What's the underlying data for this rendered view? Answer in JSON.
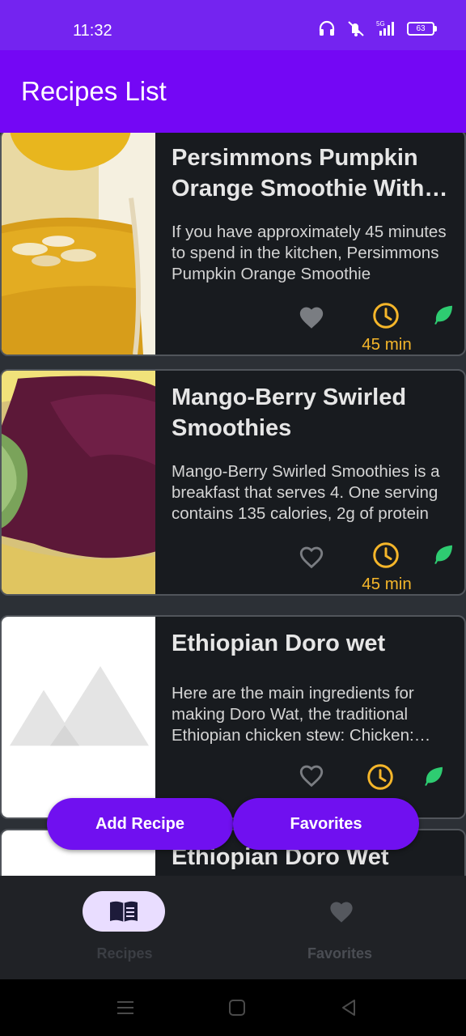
{
  "status_bar": {
    "time": "11:32",
    "network": "5G",
    "battery": "63"
  },
  "app_bar": {
    "title": "Recipes List"
  },
  "recipes": [
    {
      "title": "Persimmons Pumpkin Orange Smoothie With Chia Seeds",
      "description": "If you have approximately 45 minutes to spend in the kitchen, Persimmons Pumpkin Orange Smoothie",
      "time": "45 min",
      "favorited": true,
      "vegan": true
    },
    {
      "title": "Mango-Berry Swirled Smoothies",
      "description": "Mango-Berry Swirled Smoothies is a breakfast that serves 4. One serving contains 135 calories, 2g of protein",
      "time": "45 min",
      "favorited": false,
      "vegan": true
    },
    {
      "title": "Ethiopian Doro wet",
      "description": "Here are the main ingredients for making Doro Wat, the traditional Ethiopian chicken stew: Chicken: whole",
      "time": "",
      "favorited": false,
      "vegan": true
    },
    {
      "title": "Ethiopian Doro Wet",
      "description": "",
      "time": "",
      "favorited": false,
      "vegan": false
    }
  ],
  "actions": {
    "add_recipe": "Add Recipe",
    "favorites": "Favorites"
  },
  "bottom_nav": {
    "items": [
      {
        "label": "Recipes",
        "icon": "book-icon",
        "selected": true
      },
      {
        "label": "Favorites",
        "icon": "heart-icon",
        "selected": false
      }
    ]
  },
  "colors": {
    "primary": "#7407f5",
    "accent_time": "#f5b62a",
    "vegan_green": "#2ecc71",
    "card_bg": "#181b1f"
  }
}
